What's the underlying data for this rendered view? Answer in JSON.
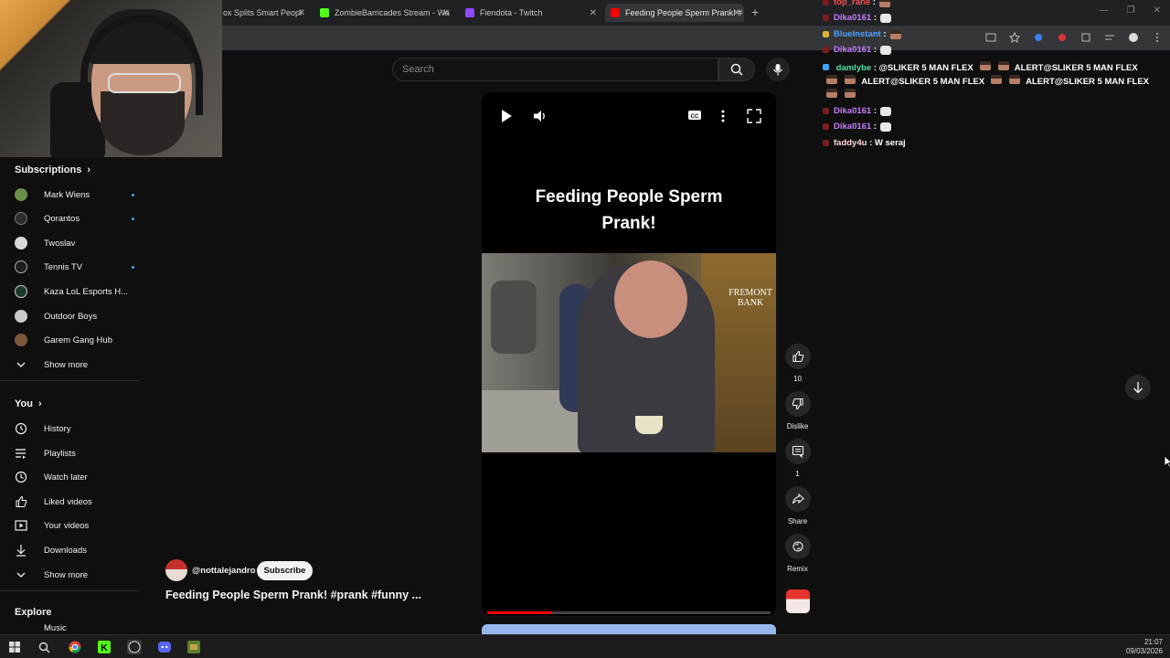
{
  "browser": {
    "tabs": [
      {
        "label": "ox Splits Smart Peopl",
        "icon_color": "#e8e8e8"
      },
      {
        "label": "ZombieBarricades Stream - Wa",
        "icon_color": "#53fc18"
      },
      {
        "label": "Fiendota - Twitch",
        "icon_color": "#9146ff"
      },
      {
        "label": "Feeding People Sperm Prank! #",
        "icon_color": "#ff0000",
        "active": true
      }
    ],
    "new_tab_icon": "plus-icon"
  },
  "search": {
    "placeholder": "Search",
    "search_icon": "search-icon",
    "mic_icon": "mic-icon"
  },
  "sidebar": {
    "subscriptions_title": "Subscriptions",
    "subscriptions": [
      {
        "label": "Mark Wiens",
        "avatar_color": "#6a8f4a",
        "new": true
      },
      {
        "label": "Qorantos",
        "avatar_color": "#2d2d2d",
        "new": true
      },
      {
        "label": "Twoslav",
        "avatar_color": "#d8d8d8",
        "new": false
      },
      {
        "label": "Tennis TV",
        "avatar_color": "#1e1e1e",
        "new": true
      },
      {
        "label": "Kaza LoL Esports H...",
        "avatar_color": "#1d3b2a",
        "new": false
      },
      {
        "label": "Outdoor Boys",
        "avatar_color": "#c9c9c9",
        "new": false
      },
      {
        "label": "Garem Gang Hub",
        "avatar_color": "#7a5a3c",
        "new": false
      }
    ],
    "show_more_1": "Show more",
    "you_title": "You",
    "you_items": [
      {
        "label": "History",
        "icon": "history-icon"
      },
      {
        "label": "Playlists",
        "icon": "playlists-icon"
      },
      {
        "label": "Watch later",
        "icon": "clock-icon"
      },
      {
        "label": "Liked videos",
        "icon": "thumb-up-icon"
      },
      {
        "label": "Your videos",
        "icon": "video-icon"
      },
      {
        "label": "Downloads",
        "icon": "download-icon"
      }
    ],
    "show_more_2": "Show more",
    "explore_title": "Explore",
    "explore_partial": "Music"
  },
  "player": {
    "caption": "Feeding People Sperm Prank!",
    "bank_sign": "FREMONT BANK",
    "progress": 0.23,
    "controls": [
      "play-icon",
      "volume-icon",
      "captions-icon",
      "more-vert-icon",
      "fullscreen-icon"
    ]
  },
  "actions": {
    "like_count": "10",
    "dislike_label": "Dislike",
    "comment_count": "1",
    "share_label": "Share",
    "remix_label": "Remix"
  },
  "video": {
    "channel": "@nottalejandro",
    "subscribe_label": "Subscribe",
    "title": "Feeding People Sperm Prank! #prank #funny ..."
  },
  "chat": {
    "messages": [
      {
        "user": "top_rane",
        "user_color": "#ff4f4f",
        "text": "",
        "emote": "face"
      },
      {
        "user": "Dika0161",
        "user_color": "#c77dff",
        "text": "",
        "emote": "ghost"
      },
      {
        "user": "BlueInstant",
        "user_color": "#4aa3ff",
        "text": "",
        "emote": "face"
      },
      {
        "user": "Dika0161",
        "user_color": "#c77dff",
        "text": "",
        "emote": "ghost"
      },
      {
        "user": "damlybe",
        "user_color": "#50e3a4",
        "text": "@SLIKER 5 MAN FLEX",
        "emote": "face"
      },
      {
        "user": "Dika0161",
        "user_color": "#c77dff",
        "text": "",
        "emote": "ghost"
      },
      {
        "user": "Dika0161",
        "user_color": "#c77dff",
        "text": "",
        "emote": "ghost"
      },
      {
        "user": "faddy4u",
        "user_color": "#ffd5d5",
        "text": "W seraj",
        "emote": ""
      }
    ],
    "alert_text": "ALERT@SLIKER 5 MAN FLEX"
  },
  "taskbar": {
    "time": "21:07",
    "date": "09/03/2026"
  },
  "colors": {
    "background": "#0f0f0f",
    "youtube_red": "#ff0000",
    "link_blue": "#3ea6ff"
  }
}
